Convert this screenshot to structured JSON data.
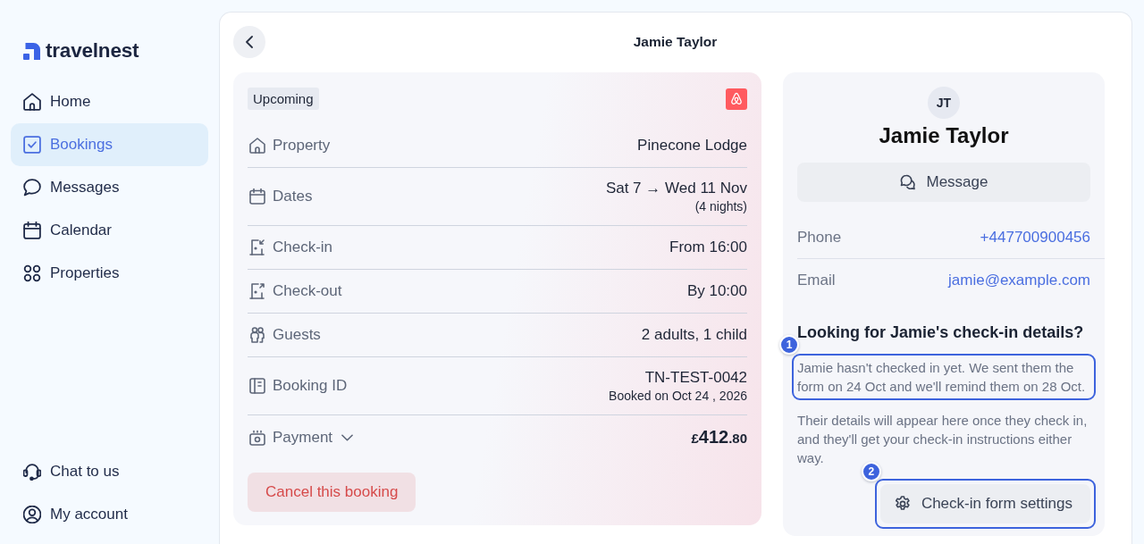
{
  "sidebar": {
    "logo": "travelnest",
    "nav": [
      {
        "label": "Home",
        "selected": false
      },
      {
        "label": "Bookings",
        "selected": true
      },
      {
        "label": "Messages",
        "selected": false
      },
      {
        "label": "Calendar",
        "selected": false
      },
      {
        "label": "Properties",
        "selected": false
      }
    ],
    "footer": [
      {
        "label": "Chat to us"
      },
      {
        "label": "My account"
      }
    ]
  },
  "header": {
    "title": "Jamie Taylor"
  },
  "booking": {
    "status": "Upcoming",
    "details": [
      {
        "label": "Property",
        "value": "Pinecone Lodge"
      },
      {
        "label": "Dates",
        "value": "Sat 7 → Wed 11 Nov",
        "note": "(4 nights)"
      },
      {
        "label": "Check-in",
        "value": "From 16:00"
      },
      {
        "label": "Check-out",
        "value": "By 10:00"
      },
      {
        "label": "Guests",
        "value": "2 adults, 1 child"
      },
      {
        "label": "Booking ID",
        "value": "TN-TEST-0042",
        "note": "Booked on Oct 24 , 2026"
      }
    ],
    "payment": {
      "label": "Payment",
      "expanded": false,
      "currency": "£",
      "amount": "412",
      "fraction": ".80"
    },
    "cancel_button": "Cancel this booking"
  },
  "guest": {
    "initials": "JT",
    "name": "Jamie Taylor",
    "message_button": "Message",
    "contacts": [
      {
        "label": "Phone",
        "value": "+447700900456"
      },
      {
        "label": "Email",
        "value": "jamie@example.com"
      }
    ]
  },
  "checkin": {
    "heading": "Looking for Jamie's check-in details?",
    "status": {
      "marker": "1",
      "text": "Jamie hasn't checked in yet. We sent them the form on 24 Oct and we'll remind them on 28 Oct."
    },
    "note": "Their details will appear here once they check in, and they'll get your check-in instructions either way.",
    "settings_button": {
      "marker": "2",
      "label": "Check-in form settings"
    }
  }
}
